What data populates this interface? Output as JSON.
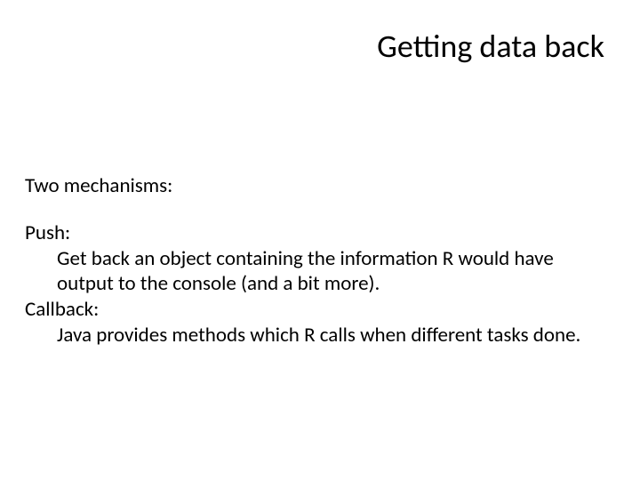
{
  "title": "Getting data back",
  "intro": "Two mechanisms:",
  "sections": [
    {
      "label": "Push:",
      "desc": "Get back an object containing the information R would have output to the console (and a bit more)."
    },
    {
      "label": "Callback:",
      "desc": "Java provides methods which R calls when different tasks done."
    }
  ]
}
